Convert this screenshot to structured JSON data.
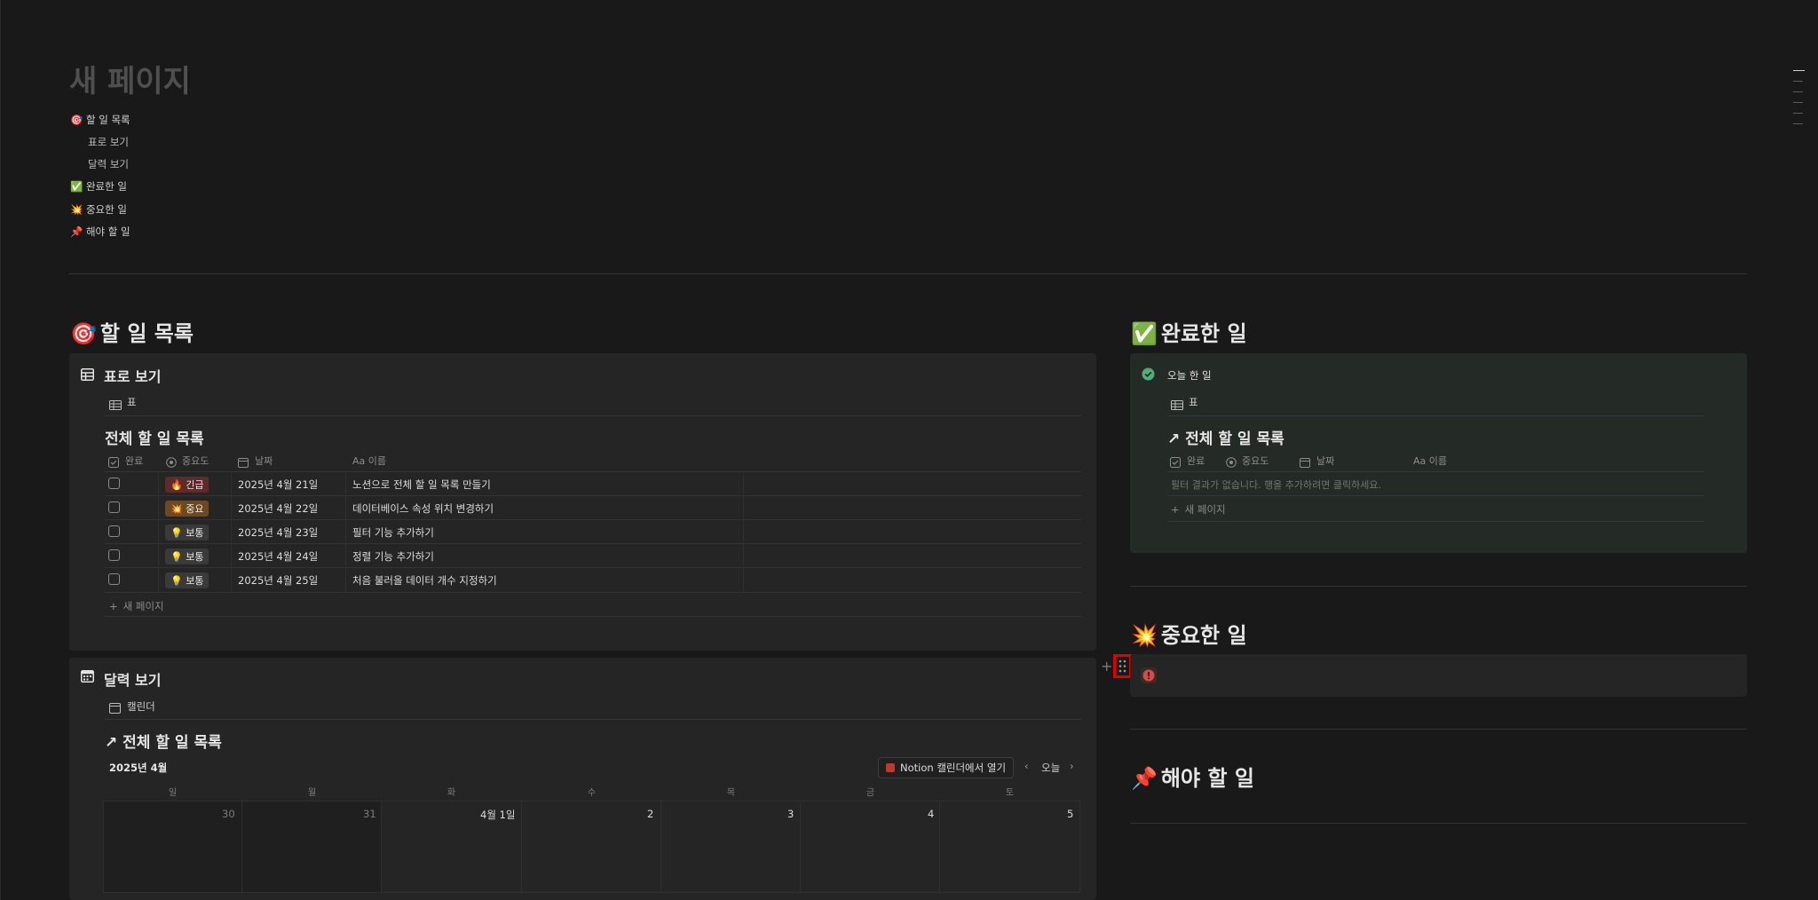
{
  "page": {
    "title": "새 페이지",
    "toc": [
      {
        "label": "🎯 할 일 목록",
        "sub": false
      },
      {
        "label": "표로 보기",
        "sub": true
      },
      {
        "label": "달력 보기",
        "sub": true
      },
      {
        "label": "✅ 완료한 일",
        "sub": false
      },
      {
        "label": "💥 중요한 일",
        "sub": false
      },
      {
        "label": "📌 해야 할 일",
        "sub": false
      }
    ]
  },
  "todo": {
    "heading_emoji": "🎯",
    "heading": "할 일 목록",
    "table_panel": {
      "title": "표로 보기",
      "view_label": "표",
      "db_title": "전체 할 일 목록",
      "columns": [
        "완료",
        "중요도",
        "날짜",
        "Aa 이름"
      ],
      "rows": [
        {
          "priority": "🔥 긴급",
          "date": "2025년 4월 21일",
          "name": "노션으로 전체 할 일 목록 만들기"
        },
        {
          "priority": "💥 중요",
          "date": "2025년 4월 22일",
          "name": "데이터베이스 속성 위치 변경하기"
        },
        {
          "priority": "💡 보통",
          "date": "2025년 4월 23일",
          "name": "필터 기능 추가하기"
        },
        {
          "priority": "💡 보통",
          "date": "2025년 4월 24일",
          "name": "정렬 기능 추가하기"
        },
        {
          "priority": "💡 보통",
          "date": "2025년 4월 25일",
          "name": "처음 불러올 데이터 개수 지정하기"
        }
      ],
      "new_page": "새 페이지"
    },
    "calendar_panel": {
      "title": "달력 보기",
      "view_label": "캘린더",
      "db_title": "↗ 전체 할 일 목록",
      "month": "2025년 4월",
      "open_button": "Notion 캘린더에서 열기",
      "today_button": "오늘",
      "weekdays": [
        "일",
        "월",
        "화",
        "수",
        "목",
        "금",
        "토"
      ],
      "days": [
        "30",
        "31",
        "4월 1일",
        "2",
        "3",
        "4",
        "5"
      ]
    }
  },
  "done": {
    "heading_emoji": "✅",
    "heading": "완료한 일",
    "panel_title": "오늘 한 일",
    "view_label": "표",
    "db_title": "↗ 전체 할 일 목록",
    "columns": [
      "완료",
      "중요도",
      "날짜",
      "Aa 이름"
    ],
    "empty_text": "필터 결과가 없습니다. 행을 추가하려면 클릭하세요.",
    "new_page": "새 페이지"
  },
  "important": {
    "heading_emoji": "💥",
    "heading": "중요한 일"
  },
  "must": {
    "heading_emoji": "📌",
    "heading": "해야 할 일"
  },
  "colors": {
    "background": "#191919",
    "panel": "#252525",
    "green_panel": "#242a25",
    "tag_urgent": "#5c2b2b",
    "tag_important": "#6b4a23",
    "tag_normal": "#3a3a3a",
    "highlight_red": "#e00000"
  }
}
